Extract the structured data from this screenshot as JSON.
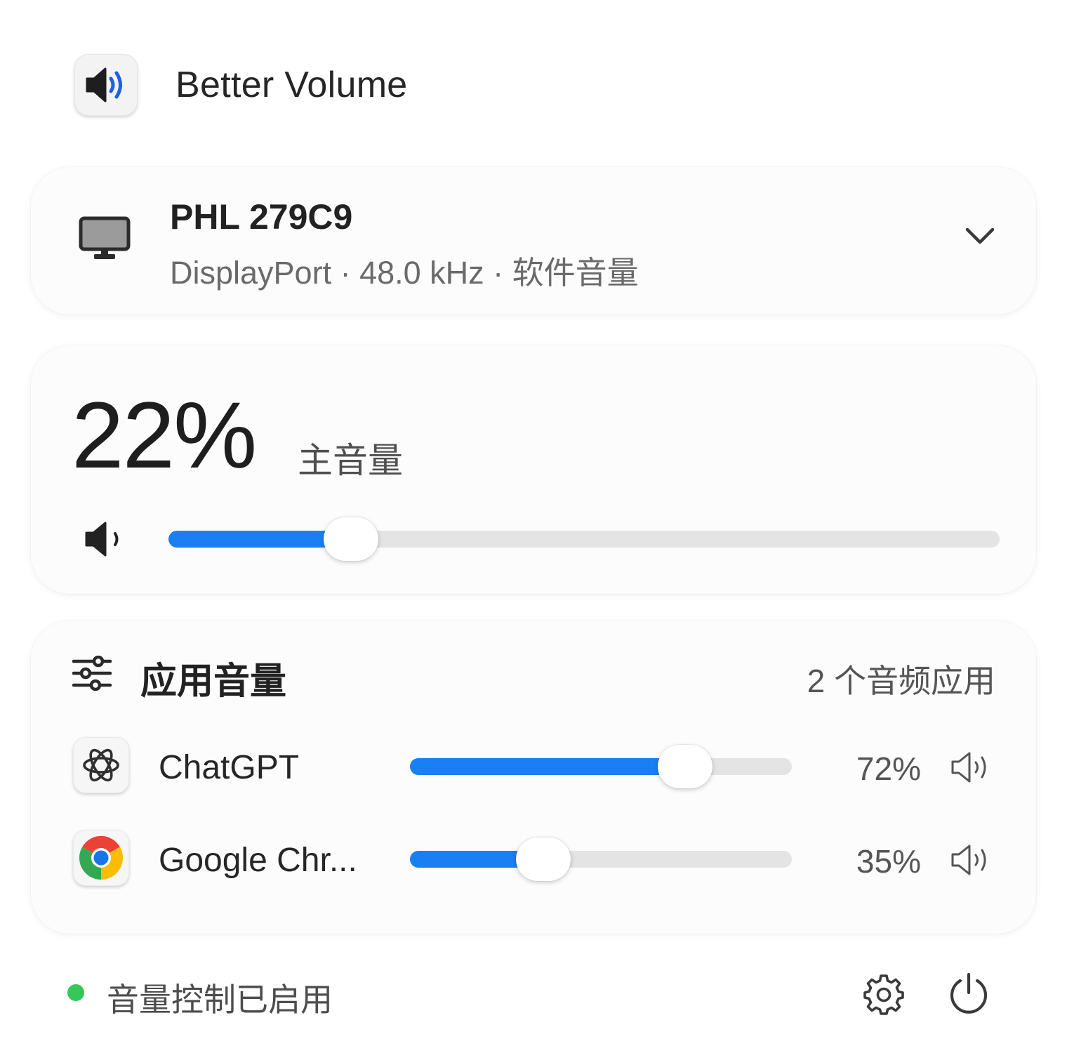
{
  "app": {
    "title": "Better Volume",
    "icon": "speaker-wave-icon",
    "accent": "#1a7ff2"
  },
  "device": {
    "name": "PHL 279C9",
    "info": "DisplayPort · 48.0 kHz · 软件音量",
    "icon": "monitor-icon"
  },
  "master": {
    "value_text": "22%",
    "label": "主音量",
    "level": 0.22
  },
  "apps_section": {
    "title": "应用音量",
    "count": "2 个音频应用",
    "items": [
      {
        "name": "ChatGPT",
        "percent": "72%",
        "level": 0.72,
        "icon": "chatgpt-logo-icon"
      },
      {
        "name": "Google Chr...",
        "percent": "35%",
        "level": 0.35,
        "icon": "chrome-logo-icon"
      }
    ]
  },
  "footer": {
    "status": "音量控制已启用",
    "status_color": "#35c759"
  }
}
